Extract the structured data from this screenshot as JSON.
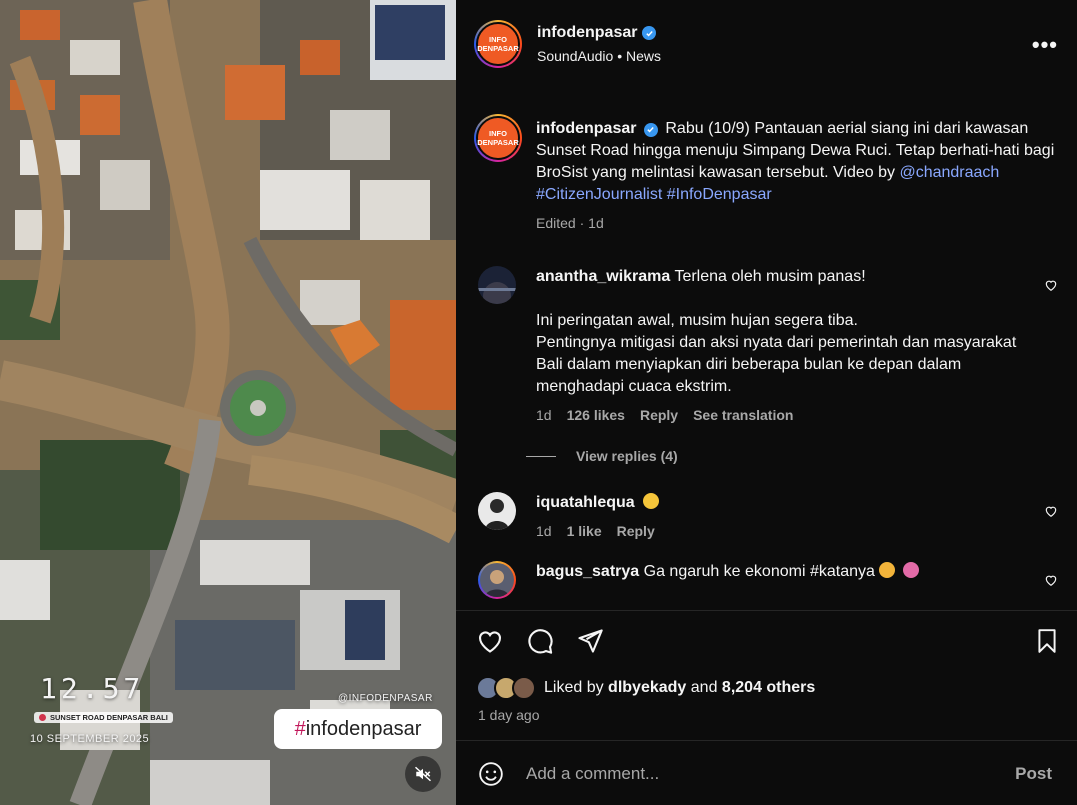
{
  "media": {
    "overlay_time": "12.57",
    "overlay_location": "SUNSET ROAD DENPASAR BALI",
    "overlay_date": "10 SEPTEMBER 2025",
    "overlay_handle": "@INFODENPASAR",
    "overlay_hashtag_symbol": "#",
    "overlay_hashtag_text": "infodenpasar",
    "mute_icon": "muted-speaker-icon"
  },
  "post": {
    "avatar_line1": "INFO",
    "avatar_line2": "DENPASAR",
    "username": "infodenpasar",
    "audio": "SoundAudio",
    "separator": "•",
    "category": "News",
    "more_icon": "•••"
  },
  "caption": {
    "username": "infodenpasar",
    "text": "Rabu (10/9) Pantauan aerial siang ini dari kawasan Sunset Road hingga menuju Simpang Dewa Ruci. Tetap berhati-hati bagi BroSist yang melintasi kawasan tersebut. Video by",
    "mention": "@chandraach",
    "tag1": "#CitizenJournalist",
    "tag2": "#InfoDenpasar",
    "edited": "Edited",
    "dot": "·",
    "time": "1d"
  },
  "comments": [
    {
      "username": "anantha_wikrama",
      "line1": "Terlena oleh musim panas!",
      "line2": "Ini peringatan awal, musim hujan segera tiba.",
      "line3": "Pentingnya mitigasi dan aksi nyata dari pemerintah dan masyarakat Bali dalam menyiapkan diri beberapa bulan ke depan dalam menghadapi cuaca ekstrim.",
      "time": "1d",
      "likes": "126 likes",
      "reply": "Reply",
      "translate": "See translation",
      "view_replies": "View replies (4)"
    },
    {
      "username": "iquatahlequa",
      "emoji": "flushed-face-emoji",
      "time": "1d",
      "likes": "1 like",
      "reply": "Reply"
    },
    {
      "username": "bagus_satrya",
      "text": "Ga ngaruh ke ekonomi",
      "tag": "#katanya",
      "emoji1": "grimacing-face-emoji",
      "emoji2": "pink-creature-emoji"
    }
  ],
  "actions": {
    "like": "heart-icon",
    "comment": "comment-icon",
    "share": "share-icon",
    "save": "bookmark-icon"
  },
  "likes": {
    "prefix": "Liked by",
    "user": "dlbyekady",
    "and": "and",
    "others": "8,204 others"
  },
  "post_time": "1 day ago",
  "comment_box": {
    "placeholder": "Add a comment...",
    "post_label": "Post"
  },
  "colors": {
    "brand_orange": "#ef5a24",
    "link_blue": "#8aa8ff",
    "verified_blue": "#3897f0"
  }
}
